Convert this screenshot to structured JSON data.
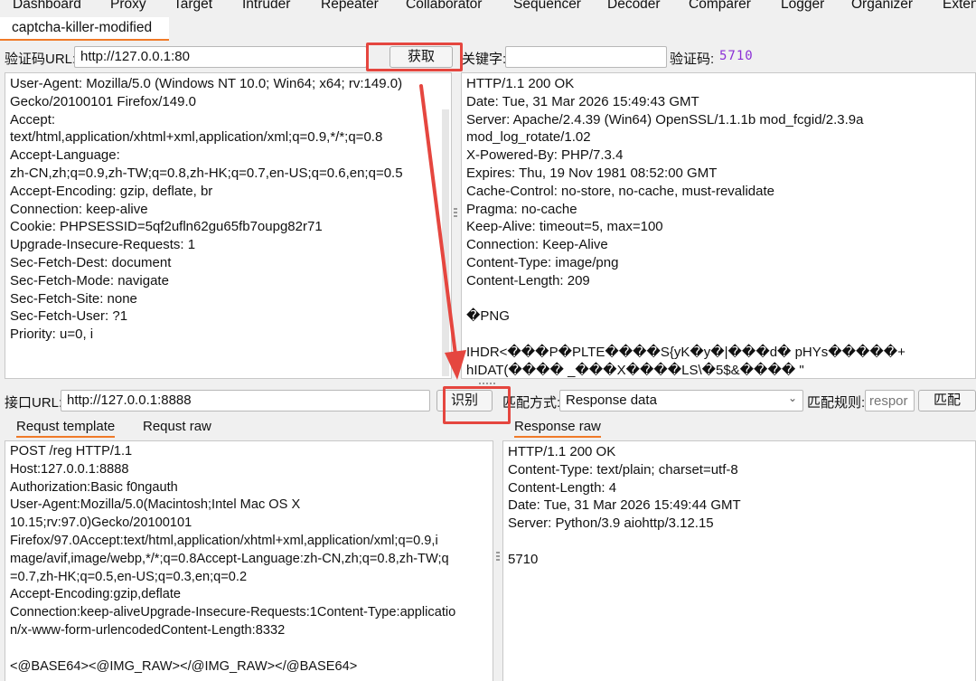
{
  "menu": [
    "Dashboard",
    "Proxy",
    "Target",
    "Intruder",
    "Repeater",
    "Collaborator",
    "Sequencer",
    "Decoder",
    "Comparer",
    "Logger",
    "Organizer",
    "Exten"
  ],
  "extension_tab": "captcha-killer-modified",
  "captcha_row": {
    "url_label": "验证码URL:",
    "url_value": "http://127.0.0.1:80",
    "fetch_button": "获取",
    "keyword_label": "关键字:",
    "keyword_value": "",
    "captcha_label": "验证码:",
    "captcha_value": "5710"
  },
  "captcha_request_text": "User-Agent: Mozilla/5.0 (Windows NT 10.0; Win64; x64; rv:149.0)\nGecko/20100101 Firefox/149.0\nAccept:\ntext/html,application/xhtml+xml,application/xml;q=0.9,*/*;q=0.8\nAccept-Language:\nzh-CN,zh;q=0.9,zh-TW;q=0.8,zh-HK;q=0.7,en-US;q=0.6,en;q=0.5\nAccept-Encoding: gzip, deflate, br\nConnection: keep-alive\nCookie: PHPSESSID=5qf2ufln62gu65fb7oupg82r71\nUpgrade-Insecure-Requests: 1\nSec-Fetch-Dest: document\nSec-Fetch-Mode: navigate\nSec-Fetch-Site: none\nSec-Fetch-User: ?1\nPriority: u=0, i",
  "captcha_response_text": "HTTP/1.1 200 OK\nDate: Tue, 31 Mar 2026 15:49:43 GMT\nServer: Apache/2.4.39 (Win64) OpenSSL/1.1.1b mod_fcgid/2.3.9a\nmod_log_rotate/1.02\nX-Powered-By: PHP/7.3.4\nExpires: Thu, 19 Nov 1981 08:52:00 GMT\nCache-Control: no-store, no-cache, must-revalidate\nPragma: no-cache\nKeep-Alive: timeout=5, max=100\nConnection: Keep-Alive\nContent-Type: image/png\nContent-Length: 209\n\n�PNG\n\nIHDR<���P�PLTE����S{yK�y�|���d� pHYs�����+\nhIDAT(���� _���X����LS\\�5$&���� \"\nf�__���]:N�U����+&����:�A!�x曼�.����e$��z��d�\n{�'[p�.�s��",
  "api_row": {
    "url_label": "接口URL:",
    "url_value": "http://127.0.0.1:8888",
    "recognize_button": "识别",
    "match_mode_label": "匹配方式:",
    "match_mode_value": "Response data",
    "match_rule_label": "匹配规则:",
    "match_rule_placeholder": "respor",
    "match_button": "匹配"
  },
  "left_tabs": [
    "Requst template",
    "Requst raw"
  ],
  "right_tabs": [
    "Response raw"
  ],
  "template_text": "POST /reg HTTP/1.1\nHost:127.0.0.1:8888\nAuthorization:Basic f0ngauth\nUser-Agent:Mozilla/5.0(Macintosh;Intel Mac OS X\n10.15;rv:97.0)Gecko/20100101\nFirefox/97.0Accept:text/html,application/xhtml+xml,application/xml;q=0.9,i\nmage/avif,image/webp,*/*;q=0.8Accept-Language:zh-CN,zh;q=0.8,zh-TW;q\n=0.7,zh-HK;q=0.5,en-US;q=0.3,en;q=0.2\nAccept-Encoding:gzip,deflate\nConnection:keep-aliveUpgrade-Insecure-Requests:1Content-Type:applicatio\nn/x-www-form-urlencodedContent-Length:8332\n\n<@BASE64><@IMG_RAW></@IMG_RAW></@BASE64>",
  "response_raw_text": "HTTP/1.1 200 OK\nContent-Type: text/plain; charset=utf-8\nContent-Length: 4\nDate: Tue, 31 Mar 2026 15:49:44 GMT\nServer: Python/3.9 aiohttp/3.12.15\n\n5710",
  "colors": {
    "accent": "#f07a28",
    "highlight": "#e5463f",
    "captcha": "#8b2fd6"
  }
}
